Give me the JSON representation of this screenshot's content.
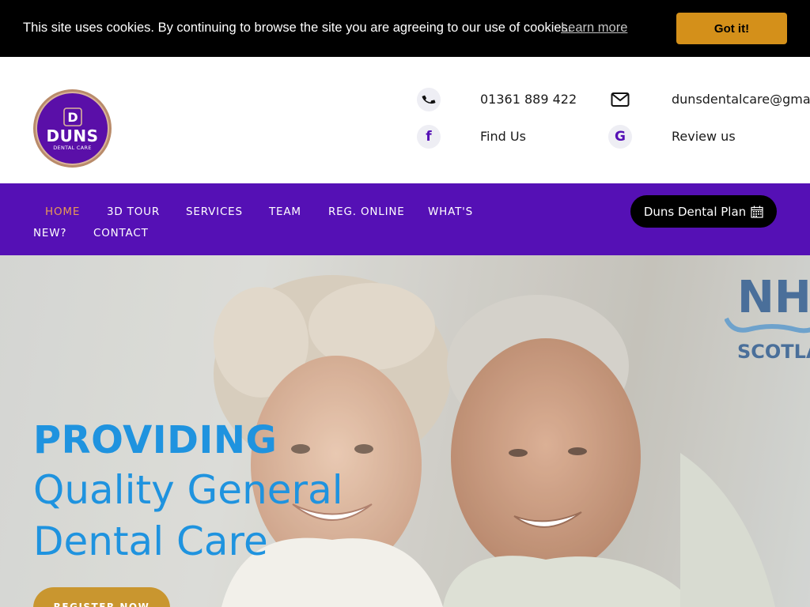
{
  "cookie_bar": {
    "message": "This site uses cookies. By continuing to browse the site you are agreeing to our use of cookies.",
    "learn_more": "Learn more",
    "accept_label": "Got it!"
  },
  "logo": {
    "name": "DUNS",
    "subtitle": "DENTAL CARE",
    "mark": "D"
  },
  "contact": {
    "phone": "01361 889 422",
    "email": "dunsdentalcare@gmail.com",
    "find_us": "Find Us",
    "review": "Review us",
    "icons": [
      "phone-icon",
      "mail-icon",
      "facebook-icon",
      "google-icon"
    ]
  },
  "nav": {
    "items": [
      {
        "label": "HOME",
        "active": true
      },
      {
        "label": "3D TOUR"
      },
      {
        "label": "SERVICES"
      },
      {
        "label": "TEAM"
      },
      {
        "label": "REG. ONLINE"
      },
      {
        "label": "WHAT'S"
      },
      {
        "label": "NEW?"
      },
      {
        "label": "CONTACT"
      }
    ],
    "plan_button": "Duns Dental Plan"
  },
  "hero": {
    "title": "PROVIDING",
    "line1": "Quality General",
    "line2": "Dental Care",
    "cta": "REGISTER NOW",
    "badge_top": "NHS",
    "badge_bottom": "SCOTLAND"
  },
  "colors": {
    "nav_bg": "#5510b5",
    "accent_blue": "#1f93df",
    "cookie_button": "#d4901a",
    "register_button": "#c9962f",
    "active_nav": "#e89a55"
  }
}
